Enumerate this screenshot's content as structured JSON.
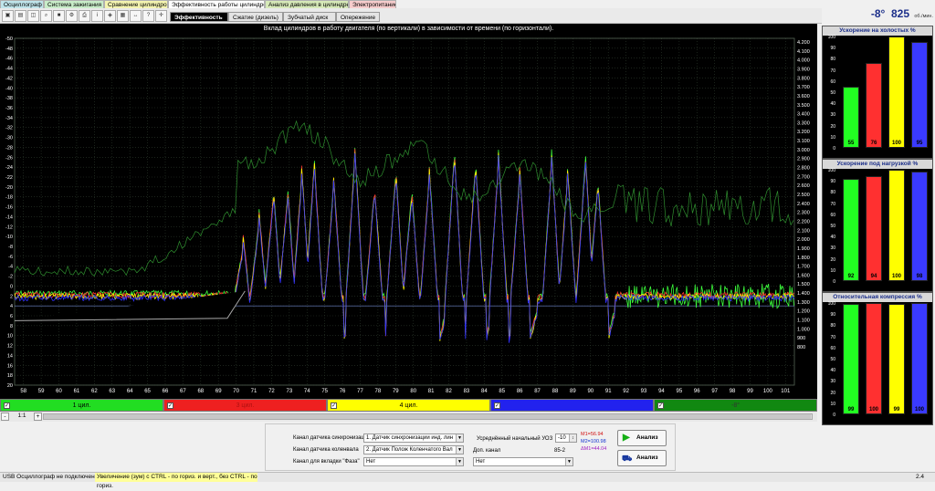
{
  "top_tabs": [
    "Осциллограф",
    "Система зажигания",
    "Сравнение цилиндров",
    "Эффективность работы цилиндров",
    "Анализ давления в цилиндре",
    "Электропитание"
  ],
  "sub_tabs": [
    "Эффективность",
    "Сжатие (дизель)",
    "Зубчатый диск",
    "Опережение"
  ],
  "rpm": {
    "angle": "-8°",
    "value": "825",
    "unit": "об./мин."
  },
  "chart_title": "Вклад цилиндров в работу двигателя (по вертикали) в зависимости от времени (по горизонтали).",
  "chart_data": {
    "type": "line",
    "title": "Вклад цилиндров в работу двигателя (по вертикали) в зависимости от времени (по горизонтали).",
    "x_ticks": [
      58,
      59,
      60,
      61,
      62,
      63,
      64,
      65,
      66,
      67,
      68,
      69,
      70,
      71,
      72,
      73,
      74,
      75,
      76,
      77,
      78,
      79,
      80,
      81,
      82,
      83,
      84,
      85,
      86,
      87,
      88,
      89,
      90,
      91,
      92,
      93,
      94,
      95,
      96,
      97,
      98,
      99,
      100,
      101
    ],
    "y_left_ticks": [
      -50,
      -48,
      -46,
      -44,
      -42,
      -40,
      -38,
      -36,
      -34,
      -32,
      -30,
      -28,
      -26,
      -24,
      -22,
      -20,
      -18,
      -16,
      -14,
      -12,
      -10,
      -8,
      -6,
      -4,
      -2,
      0,
      2,
      4,
      6,
      8,
      10,
      12,
      14,
      16,
      18,
      20
    ],
    "y_right_ticks": [
      "4.200",
      "4.100",
      "4.000",
      "3.900",
      "3.800",
      "3.700",
      "3.600",
      "3.500",
      "3.400",
      "3.300",
      "3.200",
      "3.100",
      "3.000",
      "2.900",
      "2.800",
      "2.700",
      "2.600",
      "2.500",
      "2.400",
      "2.300",
      "2.200",
      "2.100",
      "2.000",
      "1.900",
      "1.800",
      "1.700",
      "1.600",
      "1.500",
      "1.400",
      "1.300",
      "1.200",
      "1.100",
      "1.000",
      "900",
      "800"
    ],
    "ylim": [
      -50,
      20
    ],
    "xlim": [
      57.5,
      101.5
    ],
    "series": [
      {
        "name": "1 цил.",
        "color": "#3cff3c"
      },
      {
        "name": "3 цил.",
        "color": "#ff3030"
      },
      {
        "name": "4 цил.",
        "color": "#ffff00"
      },
      {
        "name": "2 цил.",
        "color": "#3030ff"
      }
    ]
  },
  "channels": [
    {
      "label": "1 цил.",
      "color": "#22dd22",
      "checked": "✓"
    },
    {
      "label": "3 цил.",
      "color": "#ee2020",
      "checked": "✓"
    },
    {
      "label": "4 цил.",
      "color": "#ffff00",
      "checked": "✓"
    },
    {
      "label": "",
      "color": "#2222ee",
      "checked": "✓"
    },
    {
      "label": "-8°",
      "color": "#118811",
      "checked": "✓"
    }
  ],
  "zoom": {
    "minus": "-",
    "ratio": "1:1",
    "plus": "+"
  },
  "controls": {
    "sync_label": "Канал датчика синхронизации",
    "sync_value": "1. Датчик синхронизации инд. лин",
    "crank_label": "Канал датчика коленвала",
    "crank_value": "2. Датчик Полож Коленчатого Вал",
    "phase_label": "Канал для вкладки \"Фаза\"",
    "phase_value": "Нет",
    "uoz_label": "Усреднённый начальный УОЗ",
    "uoz_value": "-10",
    "extra_label": "Доп. канал",
    "extra_value": "Нет",
    "extra_code": "85-2",
    "m1": "M1=56.94",
    "m2": "M2=100.98",
    "dm": "ΔM1=44.04",
    "analyze1": "Анализ",
    "analyze2": "Анализ"
  },
  "status": {
    "left": "USB Осциллограф не подключен",
    "hint": "Увеличение (зум) с CTRL - по гориз. и верт., без CTRL - по гориз.",
    "version": "2.4"
  },
  "bar_panels": [
    {
      "title": "Ускорение на холостых %",
      "values": [
        55,
        76,
        100,
        95
      ],
      "labels": [
        "55",
        "76",
        "100",
        "95"
      ],
      "cyl": [
        "1",
        "3",
        "4",
        "2"
      ],
      "colors": [
        "#22ff22",
        "#ff3030",
        "#ffff00",
        "#3a3aff"
      ]
    },
    {
      "title": "Ускорение под нагрузкой %",
      "values": [
        92,
        94,
        100,
        98
      ],
      "labels": [
        "92",
        "94",
        "100",
        "98"
      ],
      "cyl": [
        "1",
        "3",
        "4",
        "2"
      ],
      "colors": [
        "#22ff22",
        "#ff3030",
        "#ffff00",
        "#3a3aff"
      ]
    },
    {
      "title": "Относительная компрессия %",
      "values": [
        99,
        100,
        99,
        100
      ],
      "labels": [
        "99",
        "100",
        "99",
        "100"
      ],
      "cyl": [
        "1",
        "3",
        "4",
        "2"
      ],
      "colors": [
        "#22ff22",
        "#ff3030",
        "#ffff00",
        "#3a3aff"
      ]
    }
  ],
  "bar_axis": [
    "100",
    "90",
    "80",
    "70",
    "60",
    "50",
    "40",
    "30",
    "20",
    "10",
    "0"
  ]
}
